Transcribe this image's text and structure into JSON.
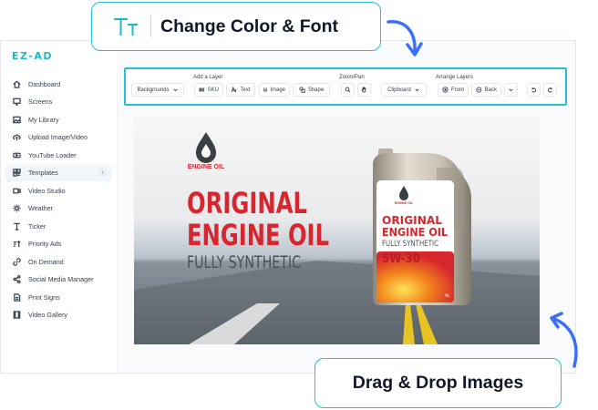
{
  "brand": "EZ-AD",
  "sidebar": {
    "items": [
      {
        "label": "Dashboard",
        "icon": "home-icon"
      },
      {
        "label": "Screens",
        "icon": "monitor-icon"
      },
      {
        "label": "My Library",
        "icon": "image-icon"
      },
      {
        "label": "Upload Image/Video",
        "icon": "upload-cloud-icon"
      },
      {
        "label": "YouTube Loader",
        "icon": "youtube-icon"
      },
      {
        "label": "Templates",
        "icon": "templates-icon",
        "active": true
      },
      {
        "label": "Video Studio",
        "icon": "video-icon"
      },
      {
        "label": "Weather",
        "icon": "sun-icon"
      },
      {
        "label": "Ticker",
        "icon": "ticker-icon"
      },
      {
        "label": "Priority Ads",
        "icon": "priority-icon"
      },
      {
        "label": "On Demand",
        "icon": "link-icon"
      },
      {
        "label": "Social Media Manager",
        "icon": "share-icon"
      },
      {
        "label": "Print Signs",
        "icon": "document-icon"
      },
      {
        "label": "Video Gallery",
        "icon": "film-icon"
      }
    ]
  },
  "toolbar": {
    "backgrounds_label": "Backgrounds",
    "add_layer_label": "Add a Layer",
    "sku_label": "SKU",
    "text_label": "Text",
    "image_label": "Image",
    "shape_label": "Shape",
    "zoom_pan_label": "Zoom/Pan",
    "clipboard_label": "Clipboard",
    "arrange_layers_label": "Arrange Layers",
    "front_label": "Front",
    "back_label": "Back"
  },
  "canvas": {
    "brand_label": "ENGINE OIL",
    "headline_line1": "ORIGINAL",
    "headline_line2": "ENGINE OIL",
    "subheadline": "FULLY SYNTHETIC",
    "jug_brand": "ENGINE OIL",
    "jug_line1": "ORIGINAL",
    "jug_line2": "ENGINE OIL",
    "jug_line3": "FULLY SYNTHETIC",
    "jug_grade": "5W-30",
    "jug_volume": "4L",
    "accent_color": "#d7262e"
  },
  "callouts": {
    "top": "Change Color & Font",
    "bottom": "Drag & Drop Images"
  },
  "colors": {
    "accent": "#22c1d3",
    "brand": "#1fb8c7"
  }
}
